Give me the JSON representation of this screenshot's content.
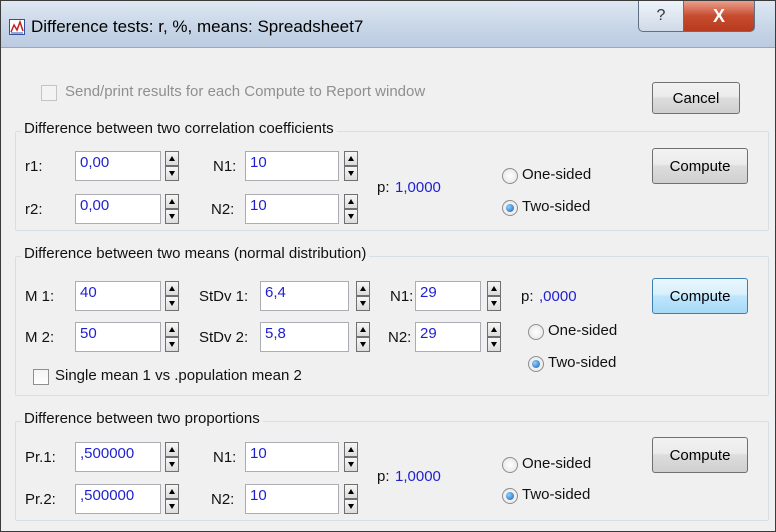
{
  "window": {
    "title": "Difference tests: r, %, means: Spreadsheet7",
    "help_label": "?",
    "close_label": "X"
  },
  "top": {
    "send_results_label": "Send/print results for each Compute to Report window",
    "send_results_checked": false,
    "send_results_enabled": false,
    "cancel_label": "Cancel"
  },
  "correlation": {
    "title": "Difference between two correlation coefficients",
    "r1_label": "r1:",
    "r1_value": "0,00",
    "r2_label": "r2:",
    "r2_value": "0,00",
    "n1_label": "N1:",
    "n1_value": "10",
    "n2_label": "N2:",
    "n2_value": "10",
    "p_label": "p:",
    "p_value": "1,0000",
    "one_sided_label": "One-sided",
    "two_sided_label": "Two-sided",
    "selected": "Two-sided",
    "compute_label": "Compute"
  },
  "means": {
    "title": "Difference between two means (normal distribution)",
    "m1_label": "M 1:",
    "m1_value": "40",
    "m2_label": "M 2:",
    "m2_value": "50",
    "sd1_label": "StDv 1:",
    "sd1_value": "6,4",
    "sd2_label": "StDv 2:",
    "sd2_value": "5,8",
    "n1_label": "N1:",
    "n1_value": "29",
    "n2_label": "N2:",
    "n2_value": "29",
    "p_label": "p:",
    "p_value": ",0000",
    "one_sided_label": "One-sided",
    "two_sided_label": "Two-sided",
    "selected": "Two-sided",
    "single_mean_label": "Single mean 1 vs .population mean 2",
    "single_mean_checked": false,
    "compute_label": "Compute"
  },
  "proportions": {
    "title": "Difference between two proportions",
    "pr1_label": "Pr.1:",
    "pr1_value": ",500000",
    "pr2_label": "Pr.2:",
    "pr2_value": ",500000",
    "n1_label": "N1:",
    "n1_value": "10",
    "n2_label": "N2:",
    "n2_value": "10",
    "p_label": "p:",
    "p_value": "1,0000",
    "one_sided_label": "One-sided",
    "two_sided_label": "Two-sided",
    "selected": "Two-sided",
    "compute_label": "Compute"
  }
}
